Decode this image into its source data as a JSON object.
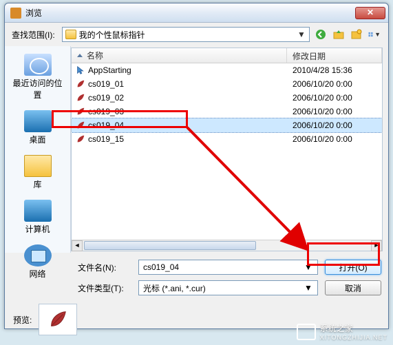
{
  "window": {
    "title": "浏览"
  },
  "toolbar": {
    "lookin_label": "查找范围(I):",
    "folder_name": "我的个性鼠标指针"
  },
  "places": [
    {
      "label": "最近访问的位置"
    },
    {
      "label": "桌面"
    },
    {
      "label": "库"
    },
    {
      "label": "计算机"
    },
    {
      "label": "网络"
    }
  ],
  "columns": {
    "name": "名称",
    "date": "修改日期"
  },
  "files": [
    {
      "name": "AppStarting",
      "date": "2010/4/28 15:36",
      "selected": false,
      "icon": "cursor"
    },
    {
      "name": "cs019_01",
      "date": "2006/10/20 0:00",
      "selected": false,
      "icon": "leaf"
    },
    {
      "name": "cs019_02",
      "date": "2006/10/20 0:00",
      "selected": false,
      "icon": "leaf"
    },
    {
      "name": "cs019_03",
      "date": "2006/10/20 0:00",
      "selected": false,
      "icon": "leaf"
    },
    {
      "name": "cs019_04",
      "date": "2006/10/20 0:00",
      "selected": true,
      "icon": "leaf"
    },
    {
      "name": "cs019_15",
      "date": "2006/10/20 0:00",
      "selected": false,
      "icon": "leaf"
    }
  ],
  "form": {
    "filename_label": "文件名(N):",
    "filename_value": "cs019_04",
    "filetype_label": "文件类型(T):",
    "filetype_value": "光标 (*.ani, *.cur)",
    "open_label": "打开(O)",
    "cancel_label": "取消"
  },
  "preview": {
    "label": "预览:"
  },
  "watermark": {
    "main": "系统之家",
    "sub": "XITONGZHIJIA.NET"
  },
  "annotations": {
    "highlight_file": "cs019_04",
    "highlight_button": "open",
    "arrow_color": "#e00000"
  }
}
